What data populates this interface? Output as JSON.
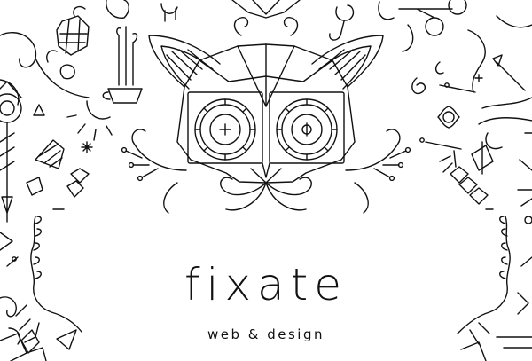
{
  "brand": {
    "name": "fixate",
    "tagline": "web & design"
  },
  "colors": {
    "background": "#ffffff",
    "ink": "#111111"
  },
  "illustration": {
    "style": "monoline folk ornament",
    "subject": "stylized lemur face with decorative ornaments"
  }
}
